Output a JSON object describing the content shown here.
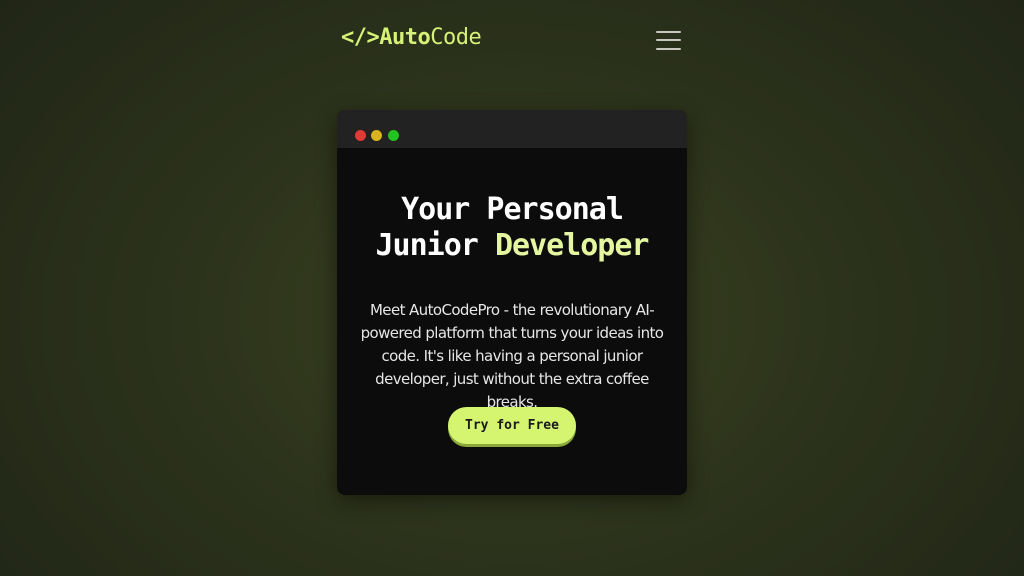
{
  "brand": {
    "symbol": "</>",
    "name_bold": "Auto",
    "name_regular": "Code"
  },
  "nav": {
    "menu_icon": "hamburger-menu-icon"
  },
  "window": {
    "controls": [
      "close-dot",
      "minimize-dot",
      "maximize-dot"
    ],
    "colors": {
      "close": "#df3a36",
      "minimize": "#d9b51d",
      "maximize": "#22c21f"
    }
  },
  "hero": {
    "headline_line1": "Your Personal",
    "headline_line2_plain": "Junior ",
    "headline_line2_accent": "Developer",
    "description": "Meet AutoCodePro - the revolutionary AI-powered platform that turns your ideas into code. It's like having a personal junior developer, just without the extra coffee breaks.",
    "cta_label": "Try for Free"
  },
  "theme": {
    "accent": "#d5f46f",
    "background": "#2c331b",
    "card": "#0c0c0c"
  }
}
